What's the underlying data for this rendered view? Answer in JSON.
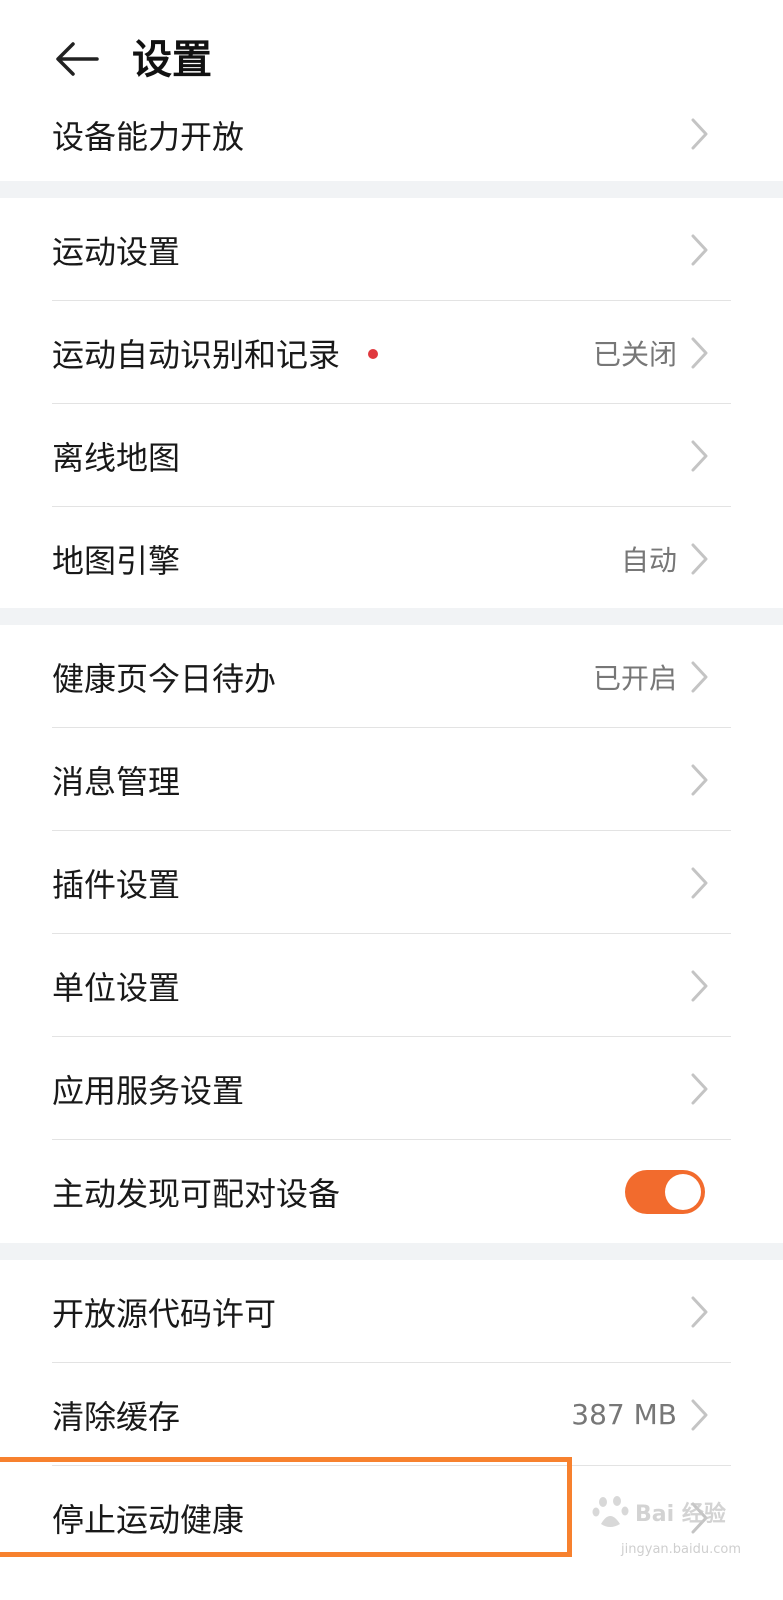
{
  "header": {
    "back_icon": "arrow-left-icon",
    "title": "设置"
  },
  "groups": [
    {
      "items": [
        {
          "label": "设备能力开放",
          "value": ""
        }
      ]
    },
    {
      "items": [
        {
          "label": "运动设置",
          "value": ""
        },
        {
          "label": "运动自动识别和记录",
          "value": "已关闭",
          "badge": "red-dot"
        },
        {
          "label": "离线地图",
          "value": ""
        },
        {
          "label": "地图引擎",
          "value": "自动"
        }
      ]
    },
    {
      "items": [
        {
          "label": "健康页今日待办",
          "value": "已开启"
        },
        {
          "label": "消息管理",
          "value": ""
        },
        {
          "label": "插件设置",
          "value": ""
        },
        {
          "label": "单位设置",
          "value": ""
        },
        {
          "label": "应用服务设置",
          "value": ""
        },
        {
          "label": "主动发现可配对设备",
          "toggle": true,
          "toggle_on": true
        }
      ]
    },
    {
      "items": [
        {
          "label": "开放源代码许可",
          "value": ""
        },
        {
          "label": "清除缓存",
          "value": "387 MB"
        },
        {
          "label": "停止运动健康",
          "value": ""
        }
      ]
    }
  ],
  "colors": {
    "accent": "#f26b2d",
    "highlight_border": "#f7812e",
    "badge_red": "#e0383e",
    "background": "#f1f3f5"
  },
  "watermark": {
    "logo_text": "Bai 经验",
    "sub_text": "jingyan.baidu.com"
  }
}
